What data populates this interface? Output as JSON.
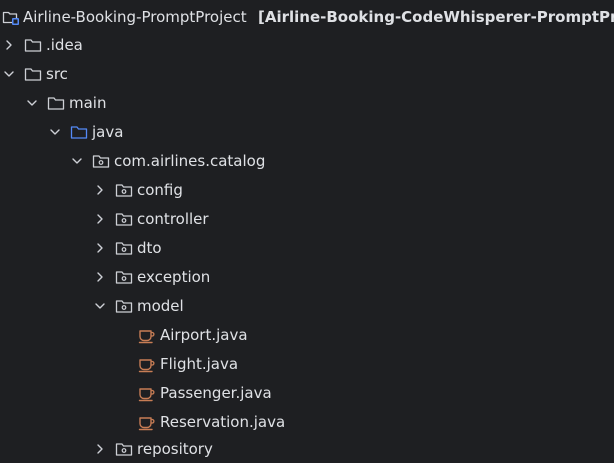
{
  "project_tree": {
    "root": {
      "name": "Airline-Booking-PromptProject",
      "module": "[Airline-Booking-CodeWhisperer-PromptPro",
      "icon": "project-folder-icon"
    },
    "idea": {
      "name": ".idea",
      "icon": "folder-icon",
      "expanded": false
    },
    "src": {
      "name": "src",
      "icon": "folder-icon",
      "expanded": true
    },
    "main": {
      "name": "main",
      "icon": "folder-icon",
      "expanded": true
    },
    "java": {
      "name": "java",
      "icon": "source-root-folder-icon",
      "expanded": true
    },
    "package": {
      "name": "com.airlines.catalog",
      "icon": "package-icon",
      "expanded": true
    },
    "packages": [
      {
        "name": "config",
        "icon": "package-icon",
        "expanded": false
      },
      {
        "name": "controller",
        "icon": "package-icon",
        "expanded": false
      },
      {
        "name": "dto",
        "icon": "package-icon",
        "expanded": false
      },
      {
        "name": "exception",
        "icon": "package-icon",
        "expanded": false
      },
      {
        "name": "model",
        "icon": "package-icon",
        "expanded": true
      },
      {
        "name": "repository",
        "icon": "package-icon",
        "expanded": false
      }
    ],
    "model_files": [
      {
        "name": "Airport.java",
        "icon": "java-file-icon"
      },
      {
        "name": "Flight.java",
        "icon": "java-file-icon"
      },
      {
        "name": "Passenger.java",
        "icon": "java-file-icon"
      },
      {
        "name": "Reservation.java",
        "icon": "java-file-icon"
      }
    ]
  },
  "colors": {
    "background": "#1e1f22",
    "text": "#dfe1e5",
    "folder_icon": "#ced0d6",
    "source_root_icon": "#548af7",
    "java_file_icon": "#c77d55"
  }
}
